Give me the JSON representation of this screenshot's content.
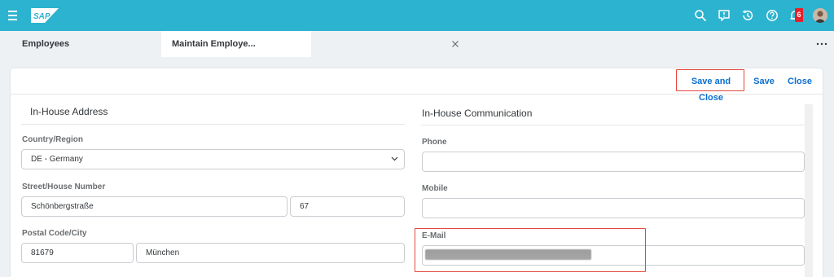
{
  "shell": {
    "logo": "SAP",
    "icons": [
      "menu-icon",
      "search-icon",
      "feedback-icon",
      "history-icon",
      "help-icon",
      "bell-icon"
    ],
    "notification_count": "6"
  },
  "tabs": [
    {
      "label": "Employees"
    },
    {
      "label": "Maintain Employe..."
    }
  ],
  "actions": {
    "save_and_close": "Save and Close",
    "save": "Save",
    "close": "Close"
  },
  "address": {
    "title": "In-House Address",
    "country_label": "Country/Region",
    "country_value": "DE - Germany",
    "street_label": "Street/House Number",
    "street_value": "Schönbergstraße",
    "house_number": "67",
    "postal_label": "Postal Code/City",
    "postal_value": "81679",
    "city_value": "München"
  },
  "communication": {
    "title": "In-House Communication",
    "phone_label": "Phone",
    "phone_value": "",
    "mobile_label": "Mobile",
    "mobile_value": "",
    "email_label": "E-Mail"
  },
  "colors": {
    "shell": "#2cb3cf",
    "link": "#0a6ed1",
    "highlight": "#e5473e",
    "badge": "#e5222c"
  }
}
